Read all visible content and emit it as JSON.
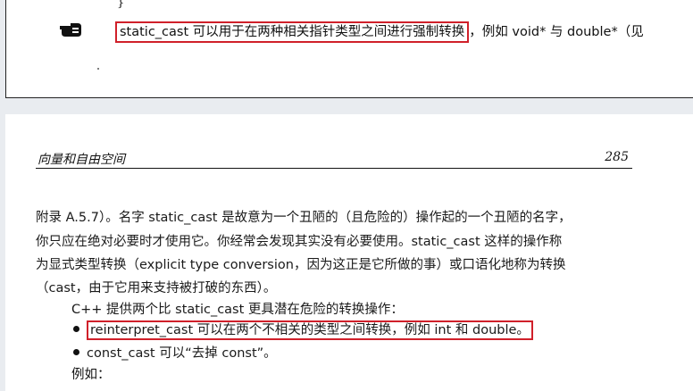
{
  "top_page": {
    "brace": "}",
    "highlighted_text": "static_cast 可以用于在两种相关指针类型之间进行强制转换",
    "trailing_text": "，例如 void* 与 double*（见"
  },
  "bottom_page": {
    "header_title": "向量和自由空间",
    "page_number": "285",
    "lines": [
      "附录 A.5.7）。名字 static_cast 是故意为一个丑陋的（且危险的）操作起的一个丑陋的名字，",
      "你只应在绝对必要时才使用它。你经常会发现其实没有必要使用。static_cast 这样的操作称",
      "为显式类型转换（explicit type conversion，因为这正是它所做的事）或口语化地称为转换",
      "（cast，由于它用来支持被打破的东西）。"
    ],
    "intro": "C++ 提供两个比 static_cast 更具潜在危险的转换操作：",
    "bullet_1": "reinterpret_cast 可以在两个不相关的类型之间转换，例如 int 和 double。",
    "bullet_2": "const_cast 可以“去掉 const”。",
    "example_label": "例如："
  },
  "colors": {
    "highlight_box": "#d0202a"
  }
}
